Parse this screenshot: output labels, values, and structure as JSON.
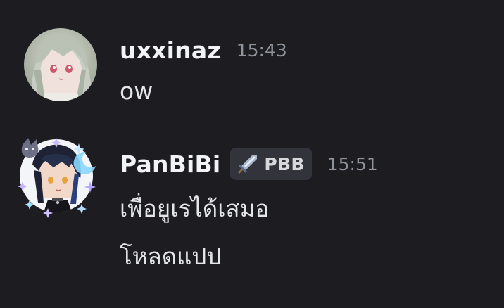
{
  "messages": [
    {
      "username": "uxxinaz",
      "timestamp": "15:43",
      "lines": [
        "ow"
      ]
    },
    {
      "username": "PanBiBi",
      "tag": {
        "icon": "sword-icon",
        "text": "PBB"
      },
      "timestamp": "15:51",
      "lines": [
        "เพื่อยูเรได้เสมอ",
        "โหลดแปป"
      ]
    }
  ],
  "colors": {
    "background": "#1c1c21",
    "username": "#f2f3f5",
    "timestamp": "#8f939b",
    "message_text": "#e3e5e8",
    "tag_background": "#33343b"
  }
}
